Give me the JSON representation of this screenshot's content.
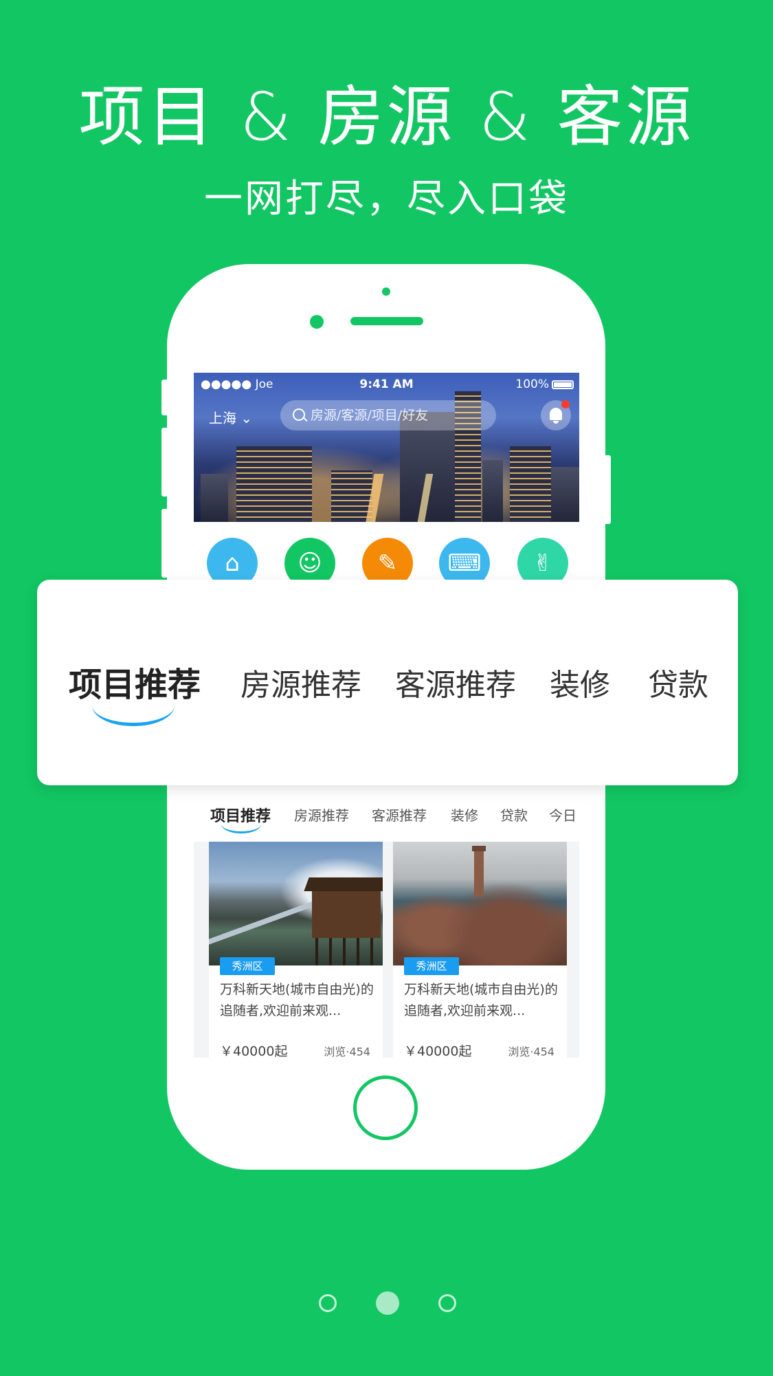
{
  "headline": "项目 & 房源 & 客源",
  "subline": "一网打尽，尽入口袋",
  "status_bar": {
    "carrier": "●●●●● Joe",
    "time": "9:41 AM",
    "battery": "100%"
  },
  "app_header": {
    "city": "上海",
    "search_placeholder": "房源/客源/项目/好友"
  },
  "category_icons": [
    {
      "icon": "house-icon",
      "color": "#3db8ef"
    },
    {
      "icon": "person-icon",
      "color": "#12c663"
    },
    {
      "icon": "note-edit-icon",
      "color": "#f58a07"
    },
    {
      "icon": "keyboard-icon",
      "color": "#3db8ef"
    },
    {
      "icon": "thumbs-up-icon",
      "color": "#2fd6a6"
    }
  ],
  "big_tabs": [
    {
      "label": "项目推荐",
      "active": true
    },
    {
      "label": "房源推荐",
      "active": false
    },
    {
      "label": "客源推荐",
      "active": false
    },
    {
      "label": "装修",
      "active": false
    },
    {
      "label": "贷款",
      "active": false
    }
  ],
  "small_tabs": [
    {
      "label": "项目推荐",
      "active": true
    },
    {
      "label": "房源推荐",
      "active": false
    },
    {
      "label": "客源推荐",
      "active": false
    },
    {
      "label": "装修",
      "active": false
    },
    {
      "label": "贷款",
      "active": false
    },
    {
      "label": "今日",
      "active": false
    }
  ],
  "listings": [
    {
      "district": "秀洲区",
      "title": "万科新天地(城市自由光)的追随者,欢迎前来观...",
      "price": "￥40000起",
      "views": "浏览·454"
    },
    {
      "district": "秀洲区",
      "title": "万科新天地(城市自由光)的追随者,欢迎前来观...",
      "price": "￥40000起",
      "views": "浏览·454"
    }
  ],
  "pager": {
    "total": 3,
    "current": 2
  },
  "colors": {
    "brand_green": "#12c663",
    "accent_blue": "#1aa4f0",
    "badge_red": "#ff3b30"
  }
}
